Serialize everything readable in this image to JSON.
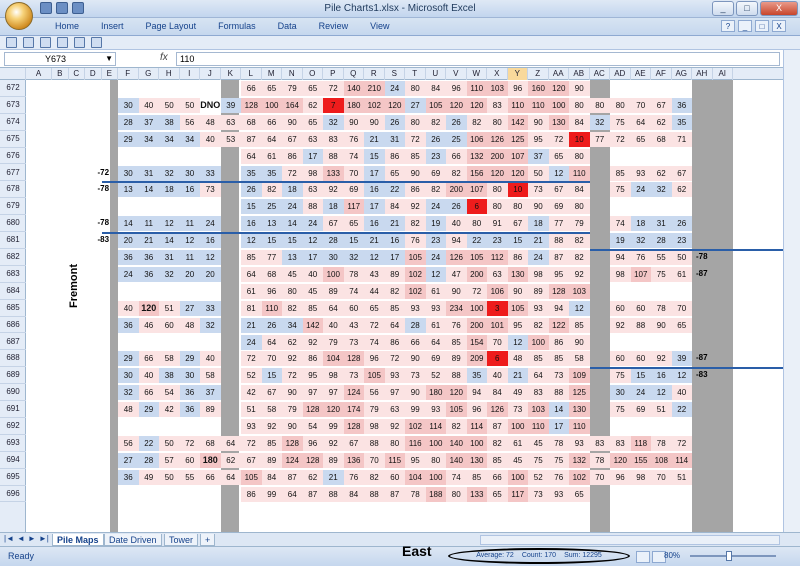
{
  "window": {
    "title": "Pile Charts1.xlsx - Microsoft Excel",
    "controls": [
      "_",
      "□",
      "X"
    ]
  },
  "ribbon": {
    "tabs": [
      "Home",
      "Insert",
      "Page Layout",
      "Formulas",
      "Data",
      "Review",
      "View"
    ],
    "right": [
      "?",
      "_",
      "□",
      "X"
    ]
  },
  "formula_bar": {
    "name_box": "Y673",
    "fx": "fx",
    "value": "110"
  },
  "columns": [
    "A",
    "B",
    "C",
    "D",
    "E",
    "F",
    "G",
    "H",
    "I",
    "J",
    "K",
    "L",
    "M",
    "N",
    "O",
    "P",
    "Q",
    "R",
    "S",
    "T",
    "U",
    "V",
    "W",
    "X",
    "Y",
    "Z",
    "AA",
    "AB",
    "AC",
    "AD",
    "AE",
    "AF",
    "AG",
    "AH",
    "AI"
  ],
  "selected_column": "Y",
  "rows": [
    "672",
    "673",
    "674",
    "675",
    "676",
    "677",
    "678",
    "679",
    "680",
    "681",
    "682",
    "683",
    "684",
    "685",
    "686",
    "687",
    "688",
    "689",
    "690",
    "691",
    "692",
    "693",
    "694",
    "695",
    "696"
  ],
  "side_labels": {
    "fremont": "Fremont",
    "left": [
      "-72",
      "-78",
      "-78",
      "-83"
    ],
    "right": [
      "-78",
      "-87",
      "-87",
      "-83"
    ]
  },
  "cells": {
    "672": {
      "L": "66",
      "M": "65",
      "N": "79",
      "O": "65",
      "P": "72",
      "Q": "140",
      "R": "210",
      "S": "24",
      "T": "80",
      "U": "84",
      "V": "96",
      "W": "110",
      "X": "103",
      "Y": "96",
      "Z": "160",
      "AA": "120",
      "AB": "90"
    },
    "673": {
      "F": "30",
      "G": "40",
      "H": "50",
      "I": "50",
      "J": "DNO",
      "K": "39",
      "L": "128",
      "M": "100",
      "N": "164",
      "O": "62",
      "P": "7",
      "Q": "180",
      "R": "102",
      "S": "120",
      "T": "27",
      "U": "105",
      "V": "120",
      "W": "120",
      "X": "83",
      "Y": "110",
      "Z": "110",
      "AA": "100",
      "AB": "80",
      "AC": "80",
      "AD": "80",
      "AE": "70",
      "AF": "67",
      "AG": "36"
    },
    "674": {
      "F": "28",
      "G": "37",
      "H": "38",
      "I": "56",
      "J": "48",
      "K": "63",
      "L": "68",
      "M": "66",
      "N": "90",
      "O": "65",
      "P": "32",
      "Q": "90",
      "R": "90",
      "S": "26",
      "T": "80",
      "U": "82",
      "V": "26",
      "W": "82",
      "X": "80",
      "Y": "142",
      "Z": "90",
      "AA": "130",
      "AB": "84",
      "AC": "32",
      "AD": "75",
      "AE": "64",
      "AF": "62",
      "AG": "35"
    },
    "675": {
      "F": "29",
      "G": "34",
      "H": "34",
      "I": "34",
      "J": "40",
      "K": "53",
      "L": "87",
      "M": "64",
      "N": "67",
      "O": "63",
      "P": "83",
      "Q": "76",
      "R": "21",
      "S": "31",
      "T": "72",
      "U": "26",
      "V": "25",
      "W": "106",
      "X": "126",
      "Y": "125",
      "Z": "95",
      "AA": "72",
      "AB": "10",
      "AC": "77",
      "AD": "72",
      "AE": "65",
      "AF": "68",
      "AG": "71"
    },
    "676": {
      "L": "64",
      "M": "61",
      "N": "86",
      "O": "17",
      "P": "88",
      "Q": "74",
      "R": "15",
      "S": "86",
      "T": "85",
      "U": "23",
      "V": "66",
      "W": "132",
      "X": "200",
      "Y": "107",
      "Z": "37",
      "AA": "65",
      "AB": "80"
    },
    "677": {
      "F": "30",
      "G": "31",
      "H": "32",
      "I": "30",
      "J": "33",
      "L": "35",
      "M": "35",
      "N": "72",
      "O": "98",
      "P": "133",
      "Q": "70",
      "R": "17",
      "S": "65",
      "T": "90",
      "U": "69",
      "V": "82",
      "W": "156",
      "X": "120",
      "Y": "120",
      "Z": "50",
      "AA": "12",
      "AB": "110",
      "AD": "85",
      "AE": "93",
      "AF": "62",
      "AG": "67"
    },
    "678": {
      "F": "13",
      "G": "14",
      "H": "18",
      "I": "16",
      "J": "73",
      "L": "26",
      "M": "82",
      "N": "18",
      "O": "63",
      "P": "92",
      "Q": "69",
      "R": "16",
      "S": "22",
      "T": "86",
      "U": "82",
      "V": "200",
      "W": "107",
      "X": "80",
      "Y": "10",
      "Z": "73",
      "AA": "67",
      "AB": "84",
      "AD": "75",
      "AE": "24",
      "AF": "32",
      "AG": "62"
    },
    "679": {
      "L": "15",
      "M": "25",
      "N": "24",
      "O": "88",
      "P": "18",
      "Q": "117",
      "R": "17",
      "S": "84",
      "T": "92",
      "U": "24",
      "V": "26",
      "W": "6",
      "X": "80",
      "Y": "80",
      "Z": "90",
      "AA": "69",
      "AB": "80"
    },
    "680": {
      "F": "14",
      "G": "11",
      "H": "12",
      "I": "11",
      "J": "24",
      "L": "16",
      "M": "13",
      "N": "14",
      "O": "24",
      "P": "67",
      "Q": "65",
      "R": "16",
      "S": "21",
      "T": "82",
      "U": "19",
      "V": "40",
      "W": "80",
      "X": "91",
      "Y": "67",
      "Z": "18",
      "AA": "77",
      "AB": "79",
      "AD": "74",
      "AE": "18",
      "AF": "31",
      "AG": "26"
    },
    "681": {
      "F": "20",
      "G": "21",
      "H": "14",
      "I": "12",
      "J": "16",
      "L": "12",
      "M": "15",
      "N": "15",
      "O": "12",
      "P": "28",
      "Q": "15",
      "R": "21",
      "S": "16",
      "T": "76",
      "U": "23",
      "V": "94",
      "W": "22",
      "X": "23",
      "Y": "15",
      "Z": "21",
      "AA": "88",
      "AB": "82",
      "AD": "19",
      "AE": "32",
      "AF": "28",
      "AG": "23"
    },
    "682": {
      "F": "36",
      "G": "36",
      "H": "31",
      "I": "11",
      "J": "12",
      "L": "85",
      "M": "77",
      "N": "13",
      "O": "17",
      "P": "30",
      "Q": "32",
      "R": "12",
      "S": "17",
      "T": "105",
      "U": "24",
      "V": "126",
      "W": "105",
      "X": "112",
      "Y": "86",
      "Z": "24",
      "AA": "87",
      "AB": "82",
      "AD": "94",
      "AE": "76",
      "AF": "55",
      "AG": "50"
    },
    "683": {
      "F": "24",
      "G": "36",
      "H": "32",
      "I": "20",
      "J": "20",
      "L": "64",
      "M": "68",
      "N": "45",
      "O": "40",
      "P": "100",
      "Q": "78",
      "R": "43",
      "S": "89",
      "T": "102",
      "U": "12",
      "V": "47",
      "W": "200",
      "X": "63",
      "Y": "130",
      "Z": "98",
      "AA": "95",
      "AB": "92",
      "AD": "98",
      "AE": "107",
      "AF": "75",
      "AG": "61"
    },
    "684": {
      "L": "61",
      "M": "96",
      "N": "80",
      "O": "45",
      "P": "89",
      "Q": "74",
      "R": "44",
      "S": "82",
      "T": "102",
      "U": "61",
      "V": "90",
      "W": "72",
      "X": "106",
      "Y": "90",
      "Z": "89",
      "AA": "128",
      "AB": "103"
    },
    "685": {
      "F": "40",
      "G": "120",
      "H": "51",
      "I": "27",
      "J": "33",
      "L": "81",
      "M": "110",
      "N": "82",
      "O": "85",
      "P": "64",
      "Q": "60",
      "R": "65",
      "S": "85",
      "T": "93",
      "U": "93",
      "V": "234",
      "W": "100",
      "X": "3",
      "Y": "105",
      "Z": "93",
      "AA": "94",
      "AB": "12",
      "AD": "60",
      "AE": "60",
      "AF": "78",
      "AG": "70"
    },
    "686": {
      "F": "36",
      "G": "46",
      "H": "60",
      "I": "48",
      "J": "32",
      "L": "21",
      "M": "26",
      "N": "34",
      "O": "142",
      "P": "40",
      "Q": "43",
      "R": "72",
      "S": "64",
      "T": "28",
      "U": "61",
      "V": "76",
      "W": "200",
      "X": "101",
      "Y": "95",
      "Z": "82",
      "AA": "122",
      "AB": "85",
      "AD": "92",
      "AE": "88",
      "AF": "90",
      "AG": "65"
    },
    "687": {
      "L": "24",
      "M": "64",
      "N": "62",
      "O": "92",
      "P": "79",
      "Q": "73",
      "R": "74",
      "S": "86",
      "T": "66",
      "U": "64",
      "V": "85",
      "W": "154",
      "X": "70",
      "Y": "12",
      "Z": "100",
      "AA": "86",
      "AB": "90"
    },
    "688": {
      "F": "29",
      "G": "66",
      "H": "58",
      "I": "29",
      "J": "40",
      "L": "72",
      "M": "70",
      "N": "92",
      "O": "86",
      "P": "104",
      "Q": "128",
      "R": "96",
      "S": "72",
      "T": "90",
      "U": "69",
      "V": "89",
      "W": "209",
      "X": "6",
      "Y": "48",
      "Z": "85",
      "AA": "85",
      "AB": "58",
      "AD": "60",
      "AE": "60",
      "AF": "92",
      "AG": "39"
    },
    "689": {
      "F": "30",
      "G": "40",
      "H": "38",
      "I": "30",
      "J": "58",
      "L": "52",
      "M": "15",
      "N": "72",
      "O": "95",
      "P": "98",
      "Q": "73",
      "R": "105",
      "S": "93",
      "T": "73",
      "U": "52",
      "V": "88",
      "W": "35",
      "X": "40",
      "Y": "21",
      "Z": "64",
      "AA": "73",
      "AB": "109",
      "AD": "75",
      "AE": "15",
      "AF": "16",
      "AG": "12"
    },
    "690": {
      "F": "32",
      "G": "66",
      "H": "54",
      "I": "36",
      "J": "37",
      "L": "42",
      "M": "67",
      "N": "90",
      "O": "97",
      "P": "97",
      "Q": "124",
      "R": "56",
      "S": "97",
      "T": "90",
      "U": "180",
      "V": "120",
      "W": "94",
      "X": "84",
      "Y": "49",
      "Z": "83",
      "AA": "88",
      "AB": "125",
      "AD": "30",
      "AE": "24",
      "AF": "12",
      "AG": "40"
    },
    "691": {
      "F": "48",
      "G": "29",
      "H": "42",
      "I": "36",
      "J": "89",
      "L": "51",
      "M": "58",
      "N": "79",
      "O": "128",
      "P": "120",
      "Q": "174",
      "R": "79",
      "S": "63",
      "T": "99",
      "U": "93",
      "V": "105",
      "W": "96",
      "X": "126",
      "Y": "73",
      "Z": "103",
      "AA": "14",
      "AB": "130",
      "AD": "75",
      "AE": "69",
      "AF": "51",
      "AG": "22"
    },
    "692": {
      "L": "93",
      "M": "92",
      "N": "90",
      "O": "54",
      "P": "99",
      "Q": "128",
      "R": "98",
      "S": "92",
      "T": "102",
      "U": "114",
      "V": "82",
      "W": "114",
      "X": "87",
      "Y": "100",
      "Z": "110",
      "AA": "17",
      "AB": "110"
    },
    "693": {
      "F": "56",
      "G": "22",
      "H": "50",
      "I": "72",
      "J": "68",
      "K": "64",
      "L": "72",
      "M": "85",
      "N": "128",
      "O": "96",
      "P": "92",
      "Q": "67",
      "R": "88",
      "S": "80",
      "T": "116",
      "U": "100",
      "V": "140",
      "W": "100",
      "X": "82",
      "Y": "61",
      "Z": "45",
      "AA": "78",
      "AB": "93",
      "AC": "83",
      "AD": "83",
      "AE": "118",
      "AF": "78",
      "AG": "72"
    },
    "694": {
      "F": "27",
      "G": "28",
      "H": "57",
      "I": "60",
      "J": "180",
      "K": "62",
      "L": "67",
      "M": "89",
      "N": "124",
      "O": "128",
      "P": "89",
      "Q": "136",
      "R": "70",
      "S": "115",
      "T": "95",
      "U": "80",
      "V": "140",
      "W": "130",
      "X": "85",
      "Y": "45",
      "Z": "75",
      "AA": "75",
      "AB": "132",
      "AC": "78",
      "AD": "120",
      "AE": "155",
      "AF": "108",
      "AG": "114"
    },
    "695": {
      "F": "36",
      "G": "49",
      "H": "50",
      "I": "55",
      "J": "66",
      "K": "64",
      "L": "105",
      "M": "84",
      "N": "87",
      "O": "62",
      "P": "21",
      "Q": "76",
      "R": "82",
      "S": "60",
      "T": "104",
      "U": "100",
      "V": "74",
      "W": "85",
      "X": "66",
      "Y": "100",
      "Z": "52",
      "AA": "76",
      "AB": "102",
      "AC": "70",
      "AD": "96",
      "AE": "98",
      "AF": "70",
      "AG": "51"
    },
    "696": {
      "L": "86",
      "M": "99",
      "N": "64",
      "O": "87",
      "P": "88",
      "Q": "84",
      "R": "88",
      "S": "87",
      "T": "78",
      "U": "188",
      "V": "80",
      "W": "133",
      "X": "65",
      "Y": "117",
      "Z": "73",
      "AA": "93",
      "AB": "65"
    }
  },
  "sheet_tabs": [
    "Pile Maps",
    "Date Driven",
    "Tower"
  ],
  "active_sheet": "Pile Maps",
  "status": {
    "ready": "Ready",
    "label": "East",
    "average": "Average: 72",
    "count": "Count: 170",
    "sum": "Sum: 12295",
    "zoom": "80%"
  },
  "colors": {
    "low": "#c9d9ef",
    "high": "#f4c6c6",
    "max": "#ee1c1c",
    "grey": "#a5a5a5"
  }
}
